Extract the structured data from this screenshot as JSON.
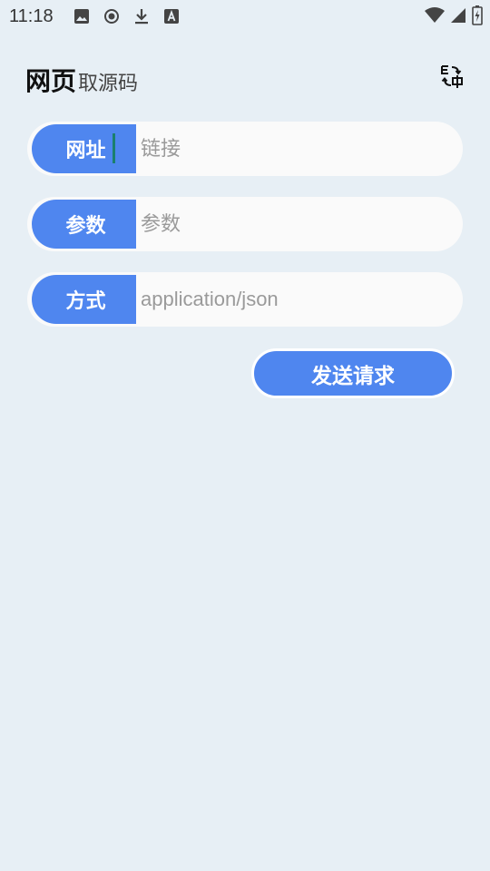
{
  "status_bar": {
    "time": "11:18",
    "left_icons": [
      "image-icon",
      "record-icon",
      "download-icon",
      "font-icon"
    ],
    "right_icons": [
      "wifi-icon",
      "signal-icon",
      "battery-icon"
    ]
  },
  "header": {
    "title": "网页",
    "subtitle": "取源码",
    "translate_icon": "translate-icon"
  },
  "form": {
    "url": {
      "label": "网址",
      "placeholder": "链接",
      "value": ""
    },
    "params": {
      "label": "参数",
      "placeholder": "参数",
      "value": ""
    },
    "method": {
      "label": "方式",
      "placeholder": "application/json",
      "value": ""
    },
    "send_label": "发送请求"
  },
  "colors": {
    "accent": "#4f86ef",
    "background": "#e7eff5",
    "field_background": "#fafafa",
    "cursor": "#1a7f6e"
  }
}
